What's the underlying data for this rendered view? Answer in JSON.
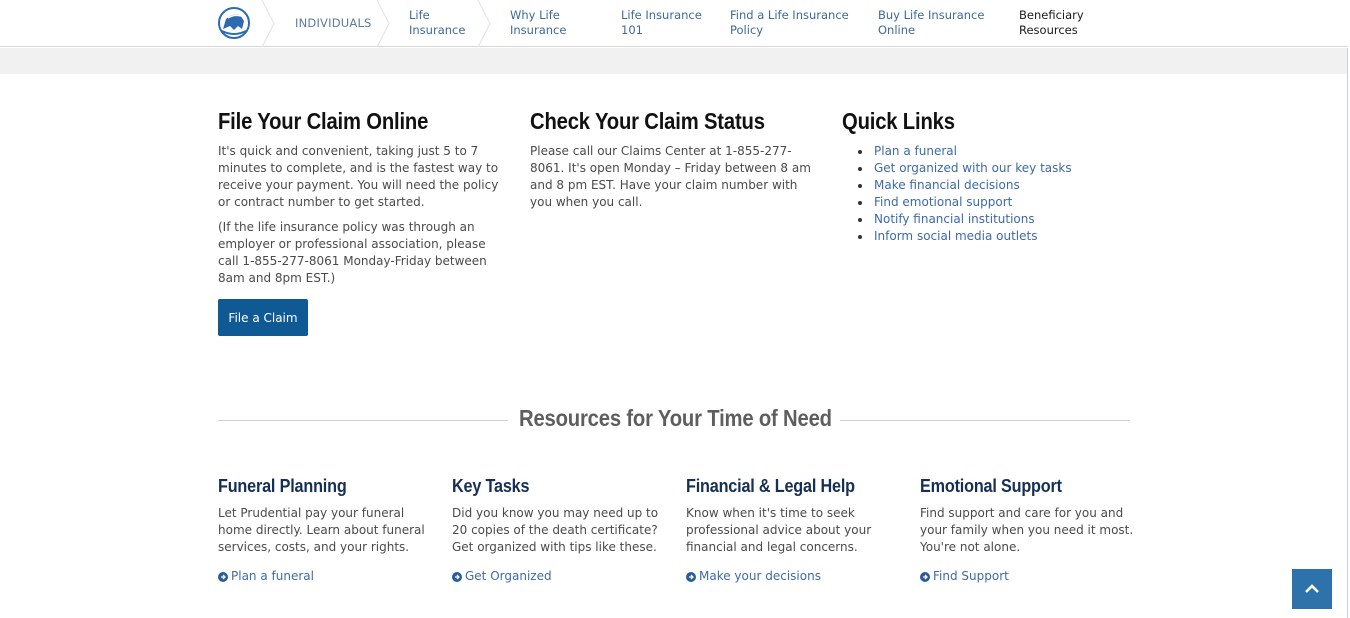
{
  "nav": {
    "logo": "prudential-rock-logo",
    "items": [
      {
        "label": "INDIVIDUALS",
        "active": false
      },
      {
        "label": "Life\nInsurance",
        "line1": "Life",
        "line2": "Insurance",
        "active": false
      },
      {
        "label": "Why Life Insurance",
        "line1": "Why Life",
        "line2": "Insurance",
        "active": false
      },
      {
        "label": "Life Insurance 101",
        "line1": "Life Insurance",
        "line2": "101",
        "active": false
      },
      {
        "label": "Find a Life Insurance Policy",
        "line1": "Find a Life Insurance",
        "line2": "Policy",
        "active": false
      },
      {
        "label": "Buy Life Insurance Online",
        "line1": "Buy Life Insurance",
        "line2": "Online",
        "active": false
      },
      {
        "label": "Beneficiary Resources",
        "line1": "Beneficiary",
        "line2": "Resources",
        "active": true
      }
    ]
  },
  "file_claim": {
    "title": "File Your Claim Online",
    "paragraph1": "It's quick and convenient, taking just 5 to 7 minutes to complete, and is the fastest way to receive your payment. You will need the policy or contract number to get started.",
    "paragraph2": "(If the life insurance policy was through an employer or professional association, please call 1-855-277-8061 Monday-Friday between 8am and 8pm EST.)",
    "button_label": "File a Claim"
  },
  "claim_status": {
    "title": "Check Your Claim Status",
    "paragraph": "Please call our Claims Center at 1-855-277-8061. It's open Monday – Friday between 8 am and 8 pm EST. Have your claim number with you when you call."
  },
  "quick_links": {
    "title": "Quick Links",
    "items": [
      "Plan a funeral",
      "Get organized with our key tasks",
      "Make financial decisions",
      "Find emotional support",
      "Notify financial institutions",
      "Inform social media outlets"
    ]
  },
  "resources": {
    "title": "Resources for Your Time of Need",
    "cards": [
      {
        "title": "Funeral Planning",
        "text": "Let Prudential pay your funeral home directly. Learn about funeral services, costs, and your rights.",
        "link": "Plan a funeral"
      },
      {
        "title": "Key Tasks",
        "text": "Did you know you may need up to 20 copies of the death certificate? Get organized with tips like these.",
        "link": "Get Organized"
      },
      {
        "title": "Financial & Legal Help",
        "text": "Know when it's time to seek professional advice about your financial and legal concerns.",
        "link": "Make your decisions"
      },
      {
        "title": "Emotional Support",
        "text": "Find support and care for you and your family when you need it most. You're not alone.",
        "link": "Find Support"
      }
    ]
  },
  "back_to_top": {
    "icon": "chevron-up-icon"
  },
  "colors": {
    "primary_button": "#0f5a94",
    "link": "#3d6aa8",
    "card_heading": "#152f57",
    "back_to_top": "#2d72ab"
  }
}
